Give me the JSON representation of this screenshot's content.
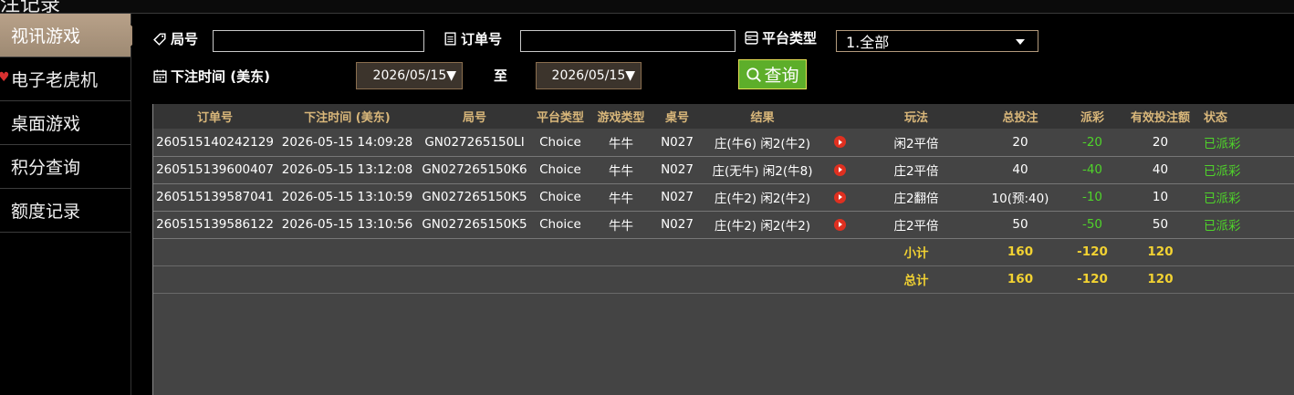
{
  "header": {
    "title": "注记录"
  },
  "sidebar": {
    "items": [
      {
        "label": "视讯游戏",
        "active": true
      },
      {
        "label": "电子老虎机"
      },
      {
        "label": "桌面游戏"
      },
      {
        "label": "积分查询"
      },
      {
        "label": "额度记录"
      }
    ]
  },
  "filters": {
    "round_label": "局号",
    "round_value": "",
    "order_label": "订单号",
    "order_value": "",
    "platform_label": "平台类型",
    "platform_selected": "1.全部",
    "time_label": "下注时间 (美东)",
    "date_from": "2026/05/15▼",
    "to_label": "至",
    "date_to": "2026/05/15▼",
    "search_label": "查询"
  },
  "table": {
    "columns": [
      "订单号",
      "下注时间 (美东)",
      "局号",
      "平台类型",
      "游戏类型",
      "桌号",
      "结果",
      "",
      "玩法",
      "总投注",
      "派彩",
      "有效投注额",
      "状态"
    ],
    "rows": [
      {
        "order": "260515140242129",
        "time": "2026-05-15 14:09:28",
        "round": "GN027265150LI",
        "platform": "Choice",
        "game": "牛牛",
        "table": "N027",
        "result": "庄(牛6) 闲2(牛2)",
        "play": "闲2平倍",
        "bet": "20",
        "payout": "-20",
        "valid": "20",
        "status": "已派彩"
      },
      {
        "order": "260515139600407",
        "time": "2026-05-15 13:12:08",
        "round": "GN027265150K6",
        "platform": "Choice",
        "game": "牛牛",
        "table": "N027",
        "result": "庄(无牛) 闲2(牛8)",
        "play": "庄2平倍",
        "bet": "40",
        "payout": "-40",
        "valid": "40",
        "status": "已派彩"
      },
      {
        "order": "260515139587041",
        "time": "2026-05-15 13:10:59",
        "round": "GN027265150K5",
        "platform": "Choice",
        "game": "牛牛",
        "table": "N027",
        "result": "庄(牛2) 闲2(牛2)",
        "play": "庄2翻倍",
        "bet": "10(预:40)",
        "payout": "-10",
        "valid": "10",
        "status": "已派彩"
      },
      {
        "order": "260515139586122",
        "time": "2026-05-15 13:10:56",
        "round": "GN027265150K5",
        "platform": "Choice",
        "game": "牛牛",
        "table": "N027",
        "result": "庄(牛2) 闲2(牛2)",
        "play": "庄2平倍",
        "bet": "50",
        "payout": "-50",
        "valid": "50",
        "status": "已派彩"
      }
    ],
    "subtotal": {
      "label": "小计",
      "bet": "160",
      "payout": "-120",
      "valid": "120"
    },
    "total": {
      "label": "总计",
      "bet": "160",
      "payout": "-120",
      "valid": "120"
    }
  },
  "colors": {
    "accent_gold": "#d9b77a",
    "payout_green": "#4fd42a",
    "sum_yellow": "#f2d232",
    "search_green": "#5dae2a",
    "play_red": "#e03020"
  }
}
